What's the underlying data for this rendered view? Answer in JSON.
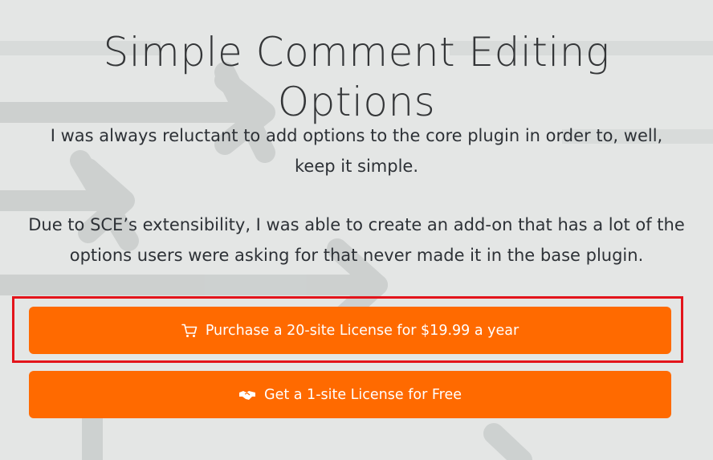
{
  "title": {
    "line1": "Simple Comment Editing",
    "line2": "Options"
  },
  "paragraphs": {
    "p1_line1": "I was always reluctant to add options to the core plugin in order to, well,",
    "p1_line2": "keep it simple.",
    "p2_line1": "Due to SCE’s extensibility, I was able to create an add-on that has a lot of the",
    "p2_line2": "options users were asking for that never made it in the base plugin."
  },
  "buttons": {
    "purchase": {
      "label": "Purchase a 20-site License for $19.99 a year",
      "icon": "shopping-cart-icon"
    },
    "free": {
      "label": "Get a 1-site License for Free",
      "icon": "handshake-icon"
    }
  },
  "colors": {
    "background": "#e4e6e5",
    "button": "#ff6a00",
    "highlight_border": "#e3141b",
    "text": "#2d3136"
  }
}
